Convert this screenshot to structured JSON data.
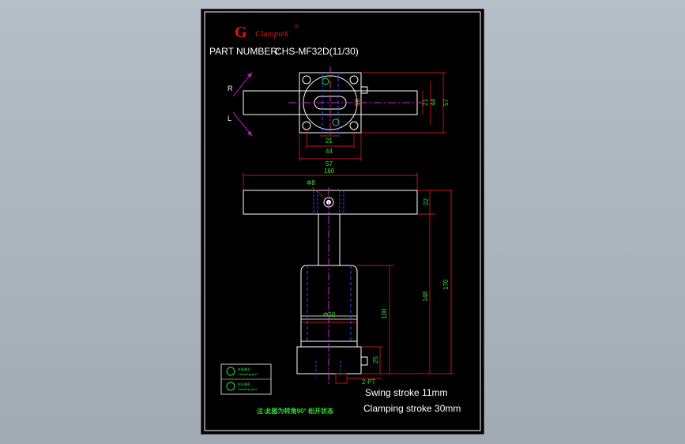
{
  "logo": {
    "letter": "G",
    "text": "Clamptek",
    "reg": "®"
  },
  "part_number": {
    "label": "PART NUMBER:",
    "value": "CHS-MF32D(11/30)"
  },
  "top_view": {
    "rotation_right": "R",
    "rotation_left": "L",
    "dims": {
      "d10": "10",
      "d21_v": "21",
      "d44_v": "44",
      "d57_v": "57",
      "d21_h": "21",
      "d44_h": "44",
      "d57_h": "57"
    }
  },
  "side_view": {
    "dims": {
      "d160": "160",
      "pin_dia": "Φ8",
      "d22": "22",
      "d148": "148",
      "d170": "170",
      "body_dia": "Φ50",
      "d100": "100",
      "d25": "25",
      "port": "2-PT"
    }
  },
  "legend": {
    "item1": {
      "cn": "夹紧端孔",
      "en": "Clamping port"
    },
    "item2": {
      "cn": "松开端孔",
      "en": "Unclamp port"
    }
  },
  "specs": {
    "swing": "Swing stroke  11mm",
    "clamping": "Clamping stroke  30mm"
  },
  "note": "注:此图为转角90° 松开状态",
  "colors": {
    "outline": "#ffffff",
    "dims": "#ff2020",
    "dim_text": "#2fe02f",
    "center": "#d020d0",
    "hidden": "#3050ff",
    "logo": "#e01818",
    "note": "#2fe02f"
  }
}
